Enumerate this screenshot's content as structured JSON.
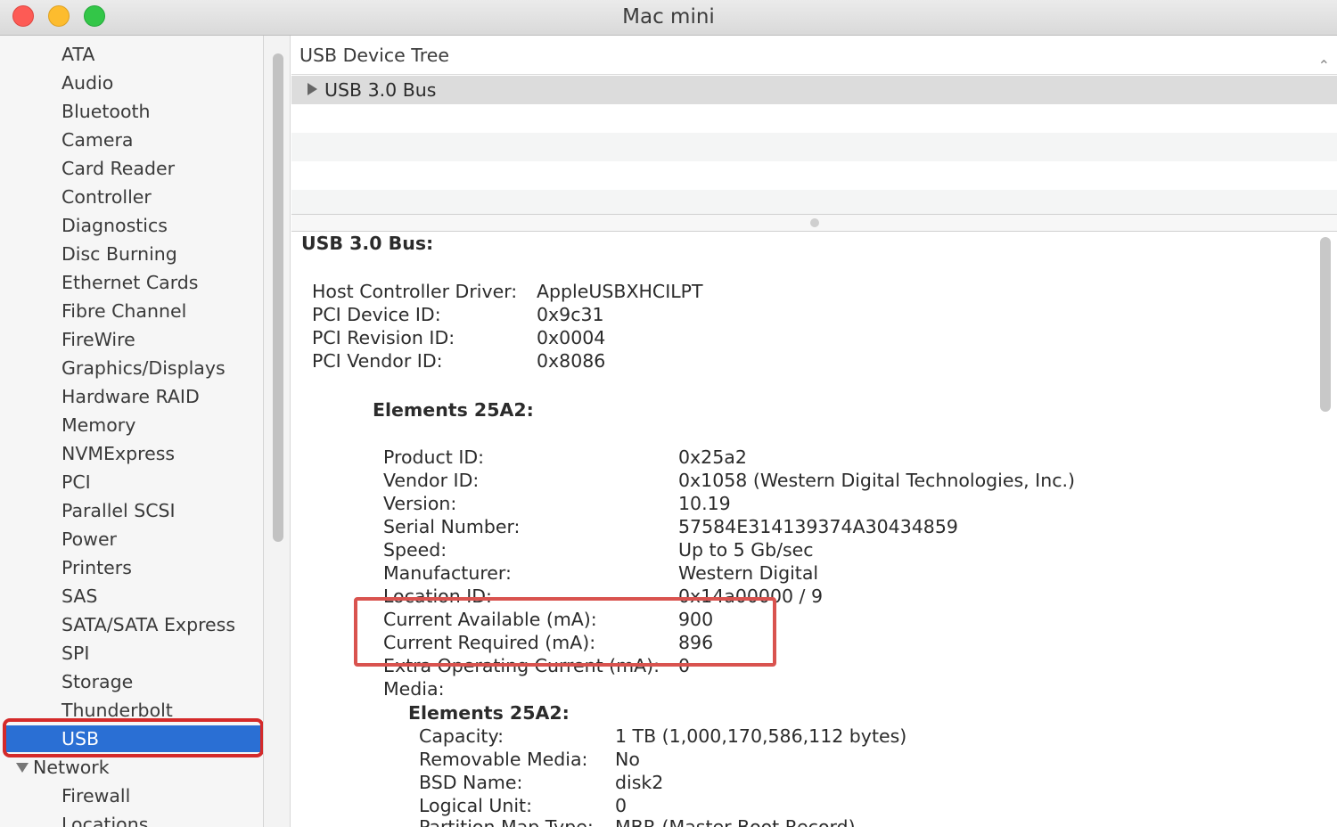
{
  "window": {
    "title": "Mac mini"
  },
  "sidebar": {
    "items": [
      {
        "label": "ATA"
      },
      {
        "label": "Audio"
      },
      {
        "label": "Bluetooth"
      },
      {
        "label": "Camera"
      },
      {
        "label": "Card Reader"
      },
      {
        "label": "Controller"
      },
      {
        "label": "Diagnostics"
      },
      {
        "label": "Disc Burning"
      },
      {
        "label": "Ethernet Cards"
      },
      {
        "label": "Fibre Channel"
      },
      {
        "label": "FireWire"
      },
      {
        "label": "Graphics/Displays"
      },
      {
        "label": "Hardware RAID"
      },
      {
        "label": "Memory"
      },
      {
        "label": "NVMExpress"
      },
      {
        "label": "PCI"
      },
      {
        "label": "Parallel SCSI"
      },
      {
        "label": "Power"
      },
      {
        "label": "Printers"
      },
      {
        "label": "SAS"
      },
      {
        "label": "SATA/SATA Express"
      },
      {
        "label": "SPI"
      },
      {
        "label": "Storage"
      },
      {
        "label": "Thunderbolt"
      },
      {
        "label": "USB"
      }
    ],
    "selected": "USB",
    "network_group": {
      "label": "Network",
      "items": [
        {
          "label": "Firewall"
        },
        {
          "label": "Locations"
        }
      ]
    }
  },
  "tree": {
    "header": "USB Device Tree",
    "selected_row": "USB 3.0 Bus"
  },
  "detail": {
    "bus_title": "USB 3.0 Bus:",
    "bus_props": [
      {
        "key": "Host Controller Driver:",
        "value": "AppleUSBXHCILPT"
      },
      {
        "key": "PCI Device ID:",
        "value": "0x9c31"
      },
      {
        "key": "PCI Revision ID:",
        "value": "0x0004"
      },
      {
        "key": "PCI Vendor ID:",
        "value": "0x8086"
      }
    ],
    "device_title": "Elements 25A2:",
    "device_props": [
      {
        "key": "Product ID:",
        "value": "0x25a2"
      },
      {
        "key": "Vendor ID:",
        "value": "0x1058  (Western Digital Technologies, Inc.)"
      },
      {
        "key": "Version:",
        "value": "10.19"
      },
      {
        "key": "Serial Number:",
        "value": "57584E314139374A30434859"
      },
      {
        "key": "Speed:",
        "value": "Up to 5 Gb/sec"
      },
      {
        "key": "Manufacturer:",
        "value": "Western Digital"
      },
      {
        "key": "Location ID:",
        "value": "0x14a00000 / 9"
      },
      {
        "key": "Current Available (mA):",
        "value": "900"
      },
      {
        "key": "Current Required (mA):",
        "value": "896"
      },
      {
        "key": "Extra Operating Current (mA):",
        "value": "0"
      }
    ],
    "media_label": "Media:",
    "media_title": "Elements 25A2:",
    "media_props": [
      {
        "key": "Capacity:",
        "value": "1 TB (1,000,170,586,112 bytes)"
      },
      {
        "key": "Removable Media:",
        "value": "No"
      },
      {
        "key": "BSD Name:",
        "value": "disk2"
      },
      {
        "key": "Logical Unit:",
        "value": "0"
      },
      {
        "key": "Partition Map Type:",
        "value": "MBR (Master Boot Record)"
      }
    ]
  },
  "colors": {
    "selection_blue": "#2a6fd4",
    "annotation_red": "#d9534f"
  }
}
